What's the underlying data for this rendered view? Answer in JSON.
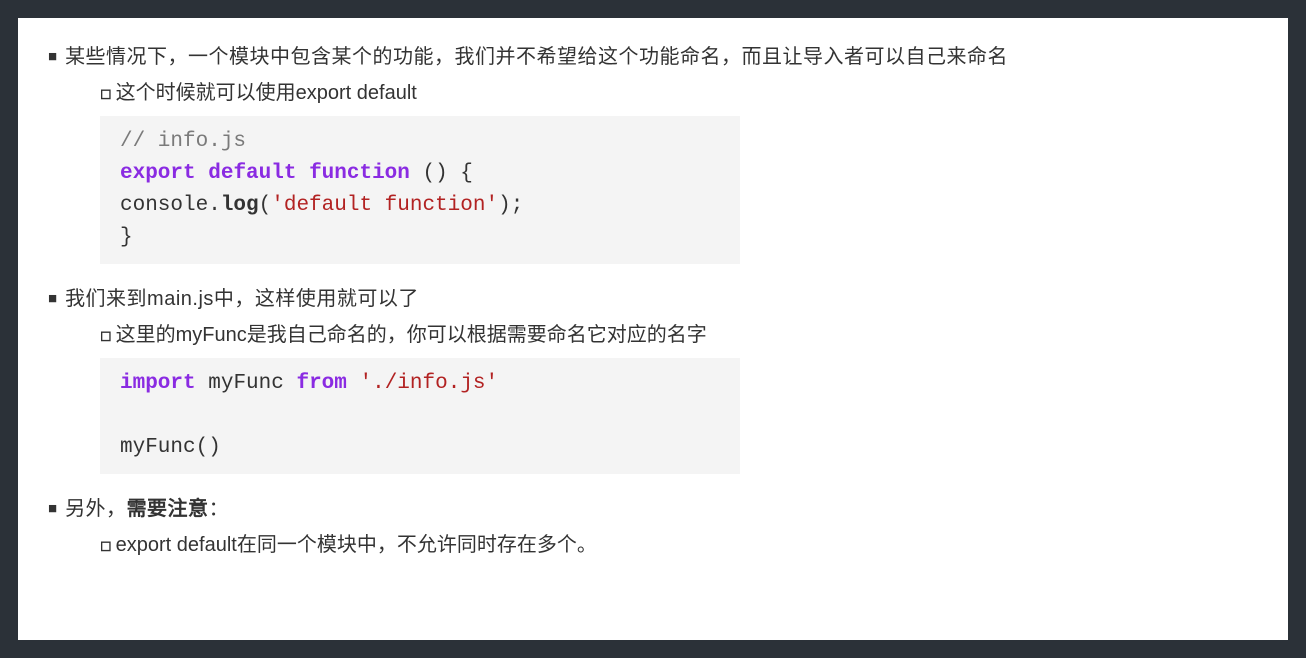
{
  "item1": {
    "text": "某些情况下，一个模块中包含某个的功能，我们并不希望给这个功能命名，而且让导入者可以自己来命名",
    "sub": "这个时候就可以使用export default"
  },
  "code1": {
    "c1": "// info.js",
    "k1": "export",
    "k2": "default",
    "k3": "function",
    "p1": " () {",
    "body1": "    console.",
    "log": "log",
    "open": "(",
    "str": "'default function'",
    "close": ");",
    "end": "}"
  },
  "item2": {
    "text": "我们来到main.js中，这样使用就可以了",
    "sub": "这里的myFunc是我自己命名的，你可以根据需要命名它对应的名字"
  },
  "code2": {
    "k1": "import",
    "name": "myFunc",
    "k2": "from",
    "str": "'./info.js'",
    "call": "myFunc",
    "paren": "()"
  },
  "item3": {
    "t1": "另外，",
    "t2": "需要注意",
    "t3": "：",
    "sub": "export default在同一个模块中，不允许同时存在多个。"
  }
}
